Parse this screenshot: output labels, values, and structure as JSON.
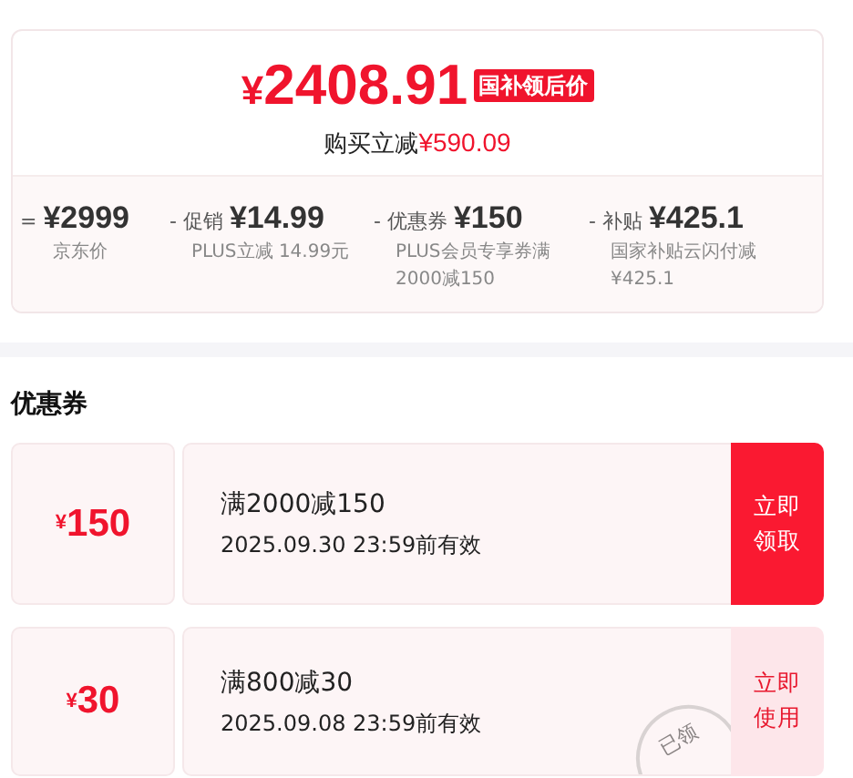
{
  "price": {
    "currency": "¥",
    "amount": "2408.91",
    "badge": "国补领后价",
    "saving_label": "购买立减",
    "saving": "¥590.09"
  },
  "breakdown": [
    {
      "sign": "=",
      "amount": "¥2999",
      "note": "京东价"
    },
    {
      "sign": "-",
      "label": "促销",
      "amount": "¥14.99",
      "note": "PLUS立减 14.99元"
    },
    {
      "sign": "-",
      "label": "优惠券",
      "amount": "¥150",
      "note": "PLUS会员专享券满2000减150"
    },
    {
      "sign": "-",
      "label": "补贴",
      "amount": "¥425.1",
      "note": "国家补贴云闪付减¥425.1"
    }
  ],
  "coupons_title": "优惠券",
  "coupons": [
    {
      "currency": "¥",
      "amount": "150",
      "condition": "满2000减150",
      "validity": "2025.09.30 23:59前有效",
      "action": "立即领取",
      "claimed": false
    },
    {
      "currency": "¥",
      "amount": "30",
      "condition": "满800减30",
      "validity": "2025.09.08 23:59前有效",
      "action": "立即使用",
      "claimed": true,
      "stamp": "已领"
    }
  ]
}
